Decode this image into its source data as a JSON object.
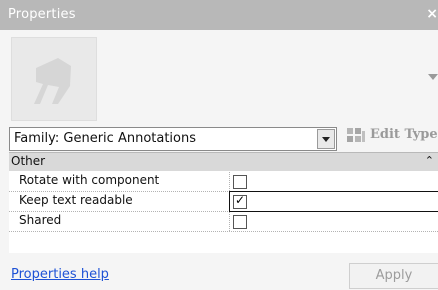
{
  "window": {
    "title": "Properties",
    "close_glyph": "×"
  },
  "family_selector": {
    "value": "Family: Generic Annotations"
  },
  "toolbar": {
    "edit_type_label": "Edit Type"
  },
  "grid": {
    "group": {
      "label": "Other",
      "collapse_glyph": "⌃"
    },
    "rows": [
      {
        "label": "Rotate with component",
        "checked": false
      },
      {
        "label": "Keep text readable",
        "checked": true
      },
      {
        "label": "Shared",
        "checked": false
      }
    ]
  },
  "footer": {
    "help_link": "Properties help",
    "apply_label": "Apply"
  },
  "icons": {
    "preview": "family-preview-icon",
    "edit": "edit-type-icon",
    "dropdown": "chevron-down-icon"
  },
  "colors": {
    "titlebar": "#b8b8b8",
    "link": "#1e52d6",
    "group_bg": "#d9d9d9"
  }
}
